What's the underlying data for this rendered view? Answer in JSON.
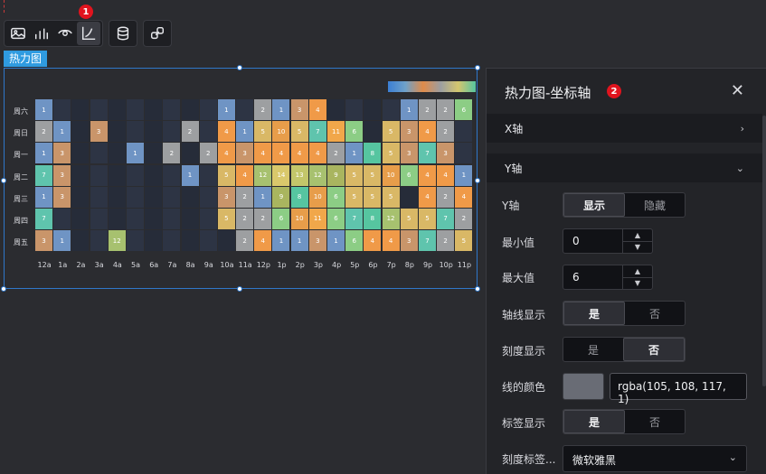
{
  "toolbar": {
    "icons": [
      "image-icon",
      "bar-chart-icon",
      "eye-icon",
      "axis-icon",
      "database-icon",
      "link-icon"
    ],
    "badge_1": "1",
    "badge_2": "2"
  },
  "component_tag": "热力图",
  "panel": {
    "title": "热力图-坐标轴",
    "close": "✕",
    "x_section": "X轴",
    "y_section": "Y轴",
    "y_axis_label": "Y轴",
    "y_axis_show": "显示",
    "y_axis_hide": "隐藏",
    "min_label": "最小值",
    "min_value": "0",
    "max_label": "最大值",
    "max_value": "6",
    "axis_line_label": "轴线显示",
    "tick_label": "刻度显示",
    "line_color_label": "线的颜色",
    "line_color_value": "rgba(105, 108, 117, 1)",
    "label_show_label": "标签显示",
    "tick_font_label": "刻度标签...",
    "tick_font_value": "微软雅黑",
    "yes": "是",
    "no": "否",
    "chevron_right": "›",
    "chevron_down": "⌄"
  },
  "chart_data": {
    "type": "heatmap",
    "y_categories": [
      "周六",
      "周日",
      "周一",
      "周二",
      "周三",
      "周四",
      "周五"
    ],
    "x_categories": [
      "12a",
      "1a",
      "2a",
      "3a",
      "4a",
      "5a",
      "6a",
      "7a",
      "8a",
      "9a",
      "10a",
      "11a",
      "12p",
      "1p",
      "2p",
      "3p",
      "4p",
      "5p",
      "6p",
      "7p",
      "8p",
      "9p",
      "10p",
      "11p"
    ],
    "rows": [
      [
        1,
        null,
        null,
        null,
        null,
        null,
        null,
        null,
        null,
        null,
        1,
        null,
        2,
        1,
        3,
        4,
        null,
        null,
        null,
        null,
        1,
        2,
        2,
        6
      ],
      [
        2,
        1,
        null,
        3,
        null,
        null,
        null,
        null,
        2,
        null,
        4,
        1,
        5,
        10,
        5,
        7,
        11,
        6,
        null,
        5,
        3,
        4,
        2,
        null
      ],
      [
        1,
        3,
        null,
        null,
        null,
        1,
        null,
        2,
        null,
        2,
        4,
        3,
        4,
        4,
        4,
        4,
        2,
        1,
        8,
        5,
        3,
        7,
        3,
        null
      ],
      [
        7,
        3,
        null,
        null,
        null,
        null,
        null,
        null,
        1,
        null,
        5,
        4,
        12,
        14,
        13,
        12,
        9,
        5,
        5,
        10,
        6,
        4,
        4,
        1
      ],
      [
        1,
        3,
        null,
        null,
        null,
        null,
        null,
        null,
        null,
        null,
        3,
        2,
        1,
        9,
        8,
        10,
        6,
        5,
        5,
        5,
        null,
        4,
        2,
        4
      ],
      [
        7,
        null,
        null,
        null,
        null,
        null,
        null,
        null,
        null,
        null,
        5,
        2,
        2,
        6,
        10,
        11,
        6,
        7,
        8,
        12,
        5,
        5,
        7,
        2
      ],
      [
        3,
        1,
        null,
        null,
        12,
        null,
        null,
        null,
        null,
        null,
        null,
        2,
        4,
        1,
        1,
        3,
        1,
        6,
        4,
        4,
        3,
        7,
        2,
        5
      ]
    ],
    "visual_map": "top-right"
  }
}
